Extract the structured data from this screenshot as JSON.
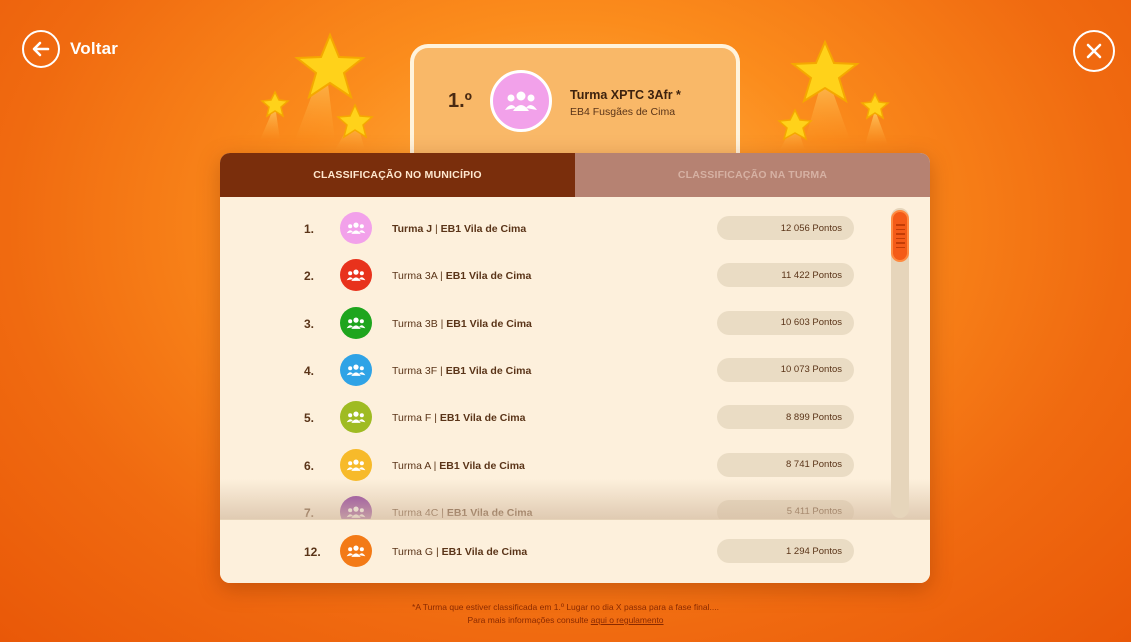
{
  "header": {
    "back_label": "Voltar"
  },
  "featured": {
    "rank": "1.º",
    "team": "Turma XPTC 3Afr *",
    "school": "EB4 Fusgães de Cima",
    "avatar_color": "#f2a1ea"
  },
  "tabs": [
    {
      "label": "CLASSIFICAÇÃO NO MUNICÍPIO",
      "active": true
    },
    {
      "label": "CLASSIFICAÇÃO NA TURMA",
      "active": false
    }
  ],
  "ranking": [
    {
      "rank": "1.",
      "team": "Turma J",
      "separator": " | ",
      "school": "EB1 Vila de Cima",
      "points": "12 056 Pontos",
      "color": "#f2a1ea",
      "bold_team": true
    },
    {
      "rank": "2.",
      "team": "Turma 3A",
      "separator": " | ",
      "school": "EB1 Vila de Cima",
      "points": "11 422 Pontos",
      "color": "#e8321c",
      "bold_team": false
    },
    {
      "rank": "3.",
      "team": "Turma 3B",
      "separator": " | ",
      "school": "EB1 Vila de Cima",
      "points": "10 603 Pontos",
      "color": "#1ea51e",
      "bold_team": false
    },
    {
      "rank": "4.",
      "team": "Turma 3F",
      "separator": " | ",
      "school": "EB1 Vila de Cima",
      "points": "10 073 Pontos",
      "color": "#2fa3e6",
      "bold_team": false
    },
    {
      "rank": "5.",
      "team": "Turma F",
      "separator": " | ",
      "school": "EB1 Vila de Cima",
      "points": "8 899 Pontos",
      "color": "#9fbb22",
      "bold_team": false
    },
    {
      "rank": "6.",
      "team": "Turma A",
      "separator": " | ",
      "school": "EB1 Vila de Cima",
      "points": "8 741 Pontos",
      "color": "#f7ba2a",
      "bold_team": false
    },
    {
      "rank": "7.",
      "team": "Turma 4C",
      "separator": " | ",
      "school": "EB1 Vila de Cima",
      "points": "5 411 Pontos",
      "color": "#8e3aa0",
      "bold_team": false
    }
  ],
  "own_entry": {
    "rank": "12.",
    "team": "Turma G",
    "separator": " | ",
    "school": "EB1 Vila de Cima",
    "points": "1 294 Pontos",
    "color": "#f37a16"
  },
  "footer": {
    "line1": "*A Turma que estiver classificada em 1.º Lugar no dia X passa para a fase final....",
    "line2_prefix": "Para mais informações consulte ",
    "line2_link": "aqui o regulamento"
  },
  "colors": {
    "accent": "#f06a10",
    "tab_active": "#7a2e0c",
    "tab_inactive": "#b68272",
    "panel": "#fdf0dc",
    "scroll_thumb": "#f45b18"
  },
  "icons": {
    "back": "arrow-left-icon",
    "close": "close-icon",
    "avatar": "group-icon",
    "decoration": "star-icon"
  }
}
